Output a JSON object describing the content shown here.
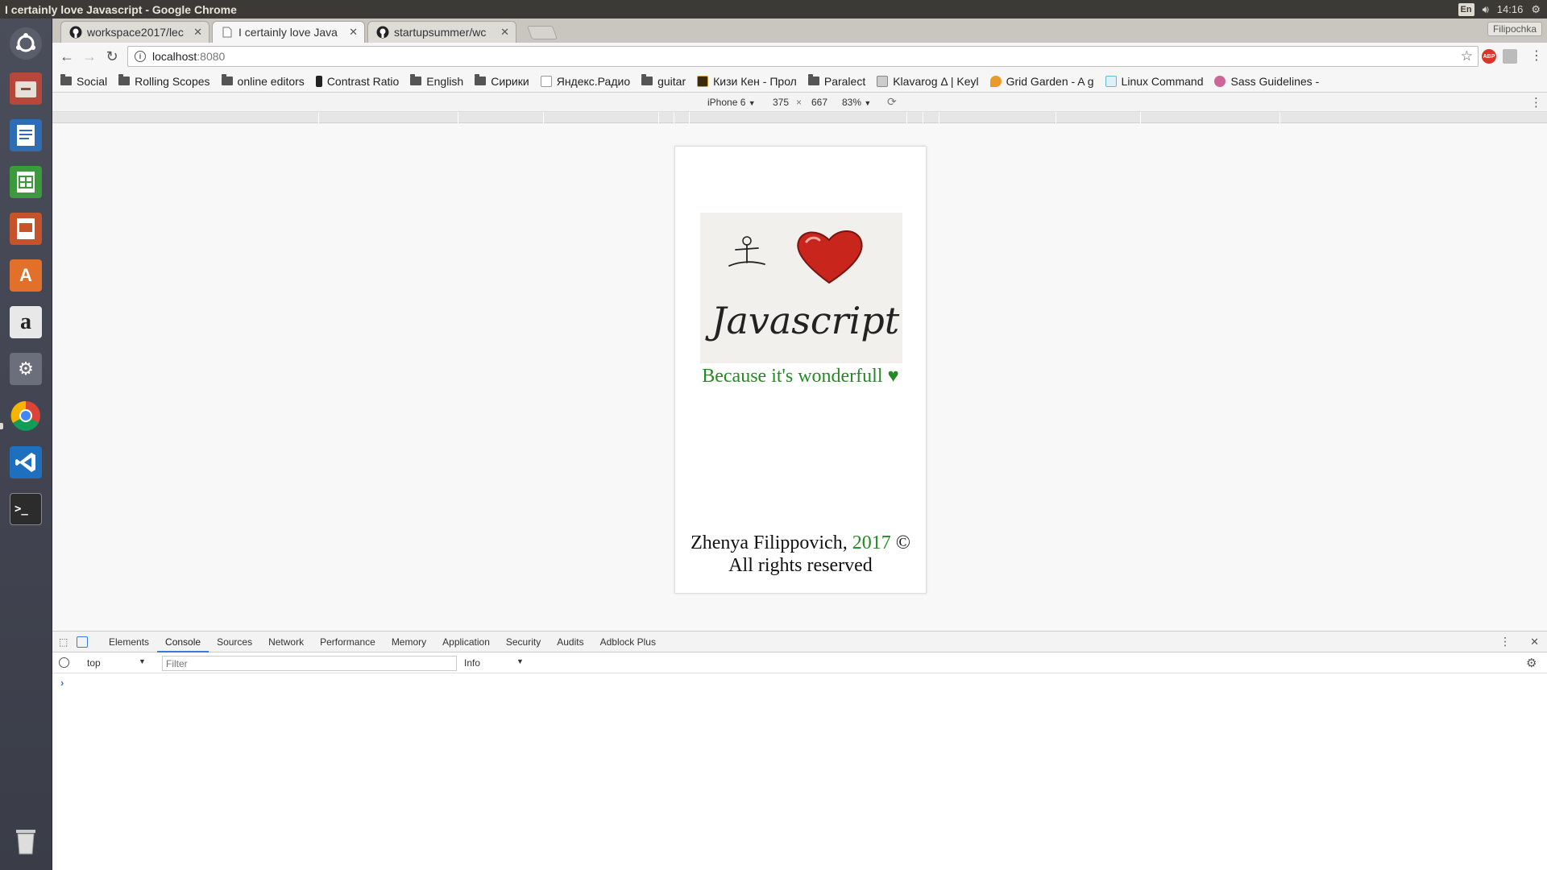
{
  "os": {
    "window_title": "I certainly love Javascript - Google Chrome",
    "keyboard_layout": "En",
    "clock": "14:16"
  },
  "browser": {
    "profile_name": "Filipochka",
    "tabs": [
      {
        "label": "workspace2017/lec",
        "favicon": "github-icon",
        "active": false
      },
      {
        "label": "I certainly love Java",
        "favicon": "page-icon",
        "active": true
      },
      {
        "label": "startupsummer/wc",
        "favicon": "github-icon",
        "active": false
      }
    ],
    "url_host": "localhost",
    "url_port": ":8080",
    "bookmarks": [
      {
        "label": "Social",
        "icon": "folder"
      },
      {
        "label": "Rolling Scopes",
        "icon": "folder"
      },
      {
        "label": "online editors",
        "icon": "folder"
      },
      {
        "label": "Contrast Ratio",
        "icon": "contrast-ratio-icon"
      },
      {
        "label": "English",
        "icon": "folder"
      },
      {
        "label": "Сирики",
        "icon": "folder"
      },
      {
        "label": "Яндекс.Радио",
        "icon": "yandex-radio-icon"
      },
      {
        "label": "guitar",
        "icon": "folder"
      },
      {
        "label": "Кизи Кен - Прол",
        "icon": "book-icon"
      },
      {
        "label": "Paralect",
        "icon": "folder"
      },
      {
        "label": "Klavarog Δ | Keyl",
        "icon": "klavarog-icon"
      },
      {
        "label": "Grid Garden - A g",
        "icon": "carrot-icon"
      },
      {
        "label": "Linux Command",
        "icon": "linux-icon"
      },
      {
        "label": "Sass Guidelines -",
        "icon": "sass-icon"
      }
    ]
  },
  "device_toolbar": {
    "device": "iPhone 6",
    "width": "375",
    "times": "×",
    "height": "667",
    "zoom": "83%"
  },
  "page": {
    "image_alt": "I ❤ Javascript",
    "image_text": "Javascript",
    "tagline": "Because it's wonderfull ♥",
    "footer_name": "Zhenya Filippovich, ",
    "footer_year": "2017",
    "footer_copy": " ©",
    "footer_rights": "All rights reserved",
    "accent_color": "#228b22"
  },
  "devtools": {
    "tabs": [
      "Elements",
      "Console",
      "Sources",
      "Network",
      "Performance",
      "Memory",
      "Application",
      "Security",
      "Audits",
      "Adblock Plus"
    ],
    "active_tab": "Console",
    "context": "top",
    "filter_placeholder": "Filter",
    "level": "Info",
    "prompt": "›"
  }
}
